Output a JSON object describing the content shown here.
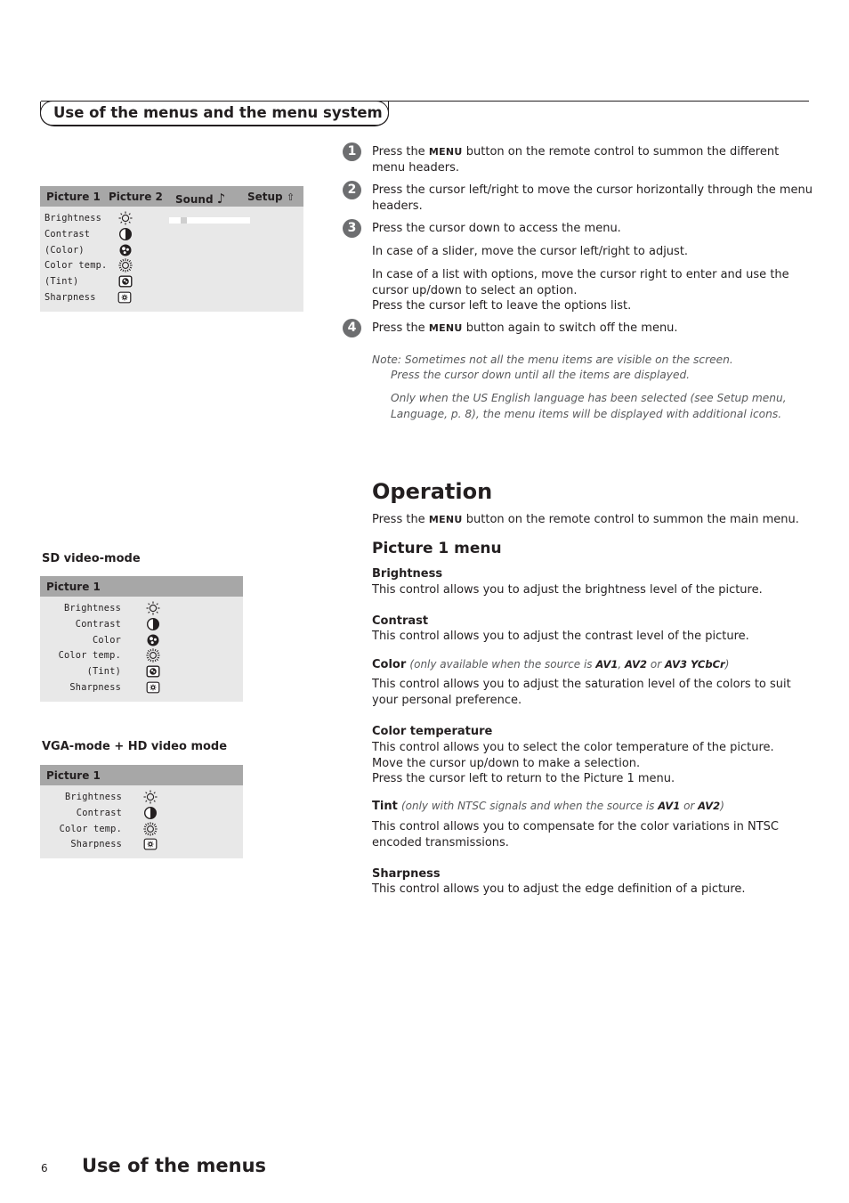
{
  "section_header": "Use of the menus and the menu system",
  "main_menu": {
    "tabs": [
      {
        "label": "Picture 1",
        "icon": null
      },
      {
        "label": "Picture 2",
        "icon": null
      },
      {
        "label": "Sound",
        "icon": "music-note-icon",
        "glyph": "♪"
      },
      {
        "label": "Setup",
        "icon": "setup-icon",
        "glyph": "⇧"
      }
    ],
    "items": [
      {
        "label": "Brightness",
        "icon": "brightness-icon"
      },
      {
        "label": "Contrast",
        "icon": "contrast-icon"
      },
      {
        "label": "(Color)",
        "icon": "color-icon"
      },
      {
        "label": "Color temp.",
        "icon": "color-temp-icon"
      },
      {
        "label": "(Tint)",
        "icon": "tint-icon"
      },
      {
        "label": "Sharpness",
        "icon": "sharpness-icon"
      }
    ],
    "brightness_slider_value_pct": 15
  },
  "sd_mode": {
    "label": "SD video-mode",
    "header": "Picture 1",
    "items": [
      {
        "label": "Brightness",
        "icon": "brightness-icon"
      },
      {
        "label": "Contrast",
        "icon": "contrast-icon"
      },
      {
        "label": "Color",
        "icon": "color-icon"
      },
      {
        "label": "Color temp.",
        "icon": "color-temp-icon"
      },
      {
        "label": "(Tint)",
        "icon": "tint-icon"
      },
      {
        "label": "Sharpness",
        "icon": "sharpness-icon"
      }
    ]
  },
  "vga_mode": {
    "label": "VGA-mode + HD video mode",
    "header": "Picture 1",
    "items": [
      {
        "label": "Brightness",
        "icon": "brightness-icon"
      },
      {
        "label": "Contrast",
        "icon": "contrast-icon"
      },
      {
        "label": "Color temp.",
        "icon": "color-temp-icon"
      },
      {
        "label": "Sharpness",
        "icon": "sharpness-icon"
      }
    ]
  },
  "steps": [
    {
      "num": "1",
      "pre": "Press the ",
      "key": "MENU",
      "post": " button on the remote control to summon the different",
      "line2": "menu headers."
    },
    {
      "num": "2",
      "text": "Press the cursor left/right to move the cursor horizontally through the menu",
      "line2": "headers."
    },
    {
      "num": "3",
      "text": "Press the cursor down to access the menu."
    },
    {
      "num": "4",
      "pre": "Press the ",
      "key": "MENU",
      "post": " button again to switch off the menu."
    }
  ],
  "step3_extra": {
    "slider": "In case of a slider, move the cursor left/right to adjust.",
    "list_1": "In case of a list with options, move the cursor right to enter and use the",
    "list_2": "cursor up/down to select an option.",
    "list_3": "Press the cursor left to leave the options list."
  },
  "note": {
    "line1": "Note: Sometimes not all the menu items are visible on the screen.",
    "line2": "Press the cursor down until all the items are displayed.",
    "line3": "Only when the US English language has been selected (see Setup menu,",
    "line4": "Language, p. 8), the menu items will be displayed with additional icons."
  },
  "operation": {
    "title": "Operation",
    "intro_pre": "Press the ",
    "intro_key": "MENU",
    "intro_post": " button on the remote control to summon the main menu.",
    "submenu_title": "Picture 1 menu",
    "controls": {
      "brightness": {
        "title": "Brightness",
        "desc": "This control allows you to adjust the brightness level of the picture."
      },
      "contrast": {
        "title": "Contrast",
        "desc": "This control allows you to adjust the contrast level of the picture."
      },
      "color": {
        "title": "Color",
        "cond_pre": "(only available when the source is ",
        "src1": "AV1",
        "sep": ", ",
        "src2": "AV2",
        "or": " or ",
        "src3": "AV3 YCbCr",
        "cond_post": ")",
        "desc1": "This control allows you to adjust the saturation level of the colors to suit",
        "desc2": "your personal preference."
      },
      "color_temp": {
        "title": "Color temperature",
        "desc1": "This control allows you to select the color temperature of the picture.",
        "desc2": "Move the cursor up/down to make a selection.",
        "desc3": "Press the cursor left to return to the Picture 1 menu."
      },
      "tint": {
        "title": "Tint",
        "cond_pre": "(only with NTSC signals and when the source is ",
        "src1": "AV1",
        "or": " or ",
        "src2": "AV2",
        "cond_post": ")",
        "desc1": "This control allows you to compensate for the color variations in NTSC",
        "desc2": "encoded transmissions."
      },
      "sharpness": {
        "title": "Sharpness",
        "desc": "This control allows you to adjust the edge definition of a picture."
      }
    }
  },
  "footer": {
    "page_number": "6",
    "title": "Use of the menus"
  },
  "colors": {
    "osd_header": "#a7a7a7",
    "osd_body": "#e8e8e8",
    "step_badge": "#6d6e70",
    "text": "#231f20",
    "note_text": "#58595b"
  }
}
